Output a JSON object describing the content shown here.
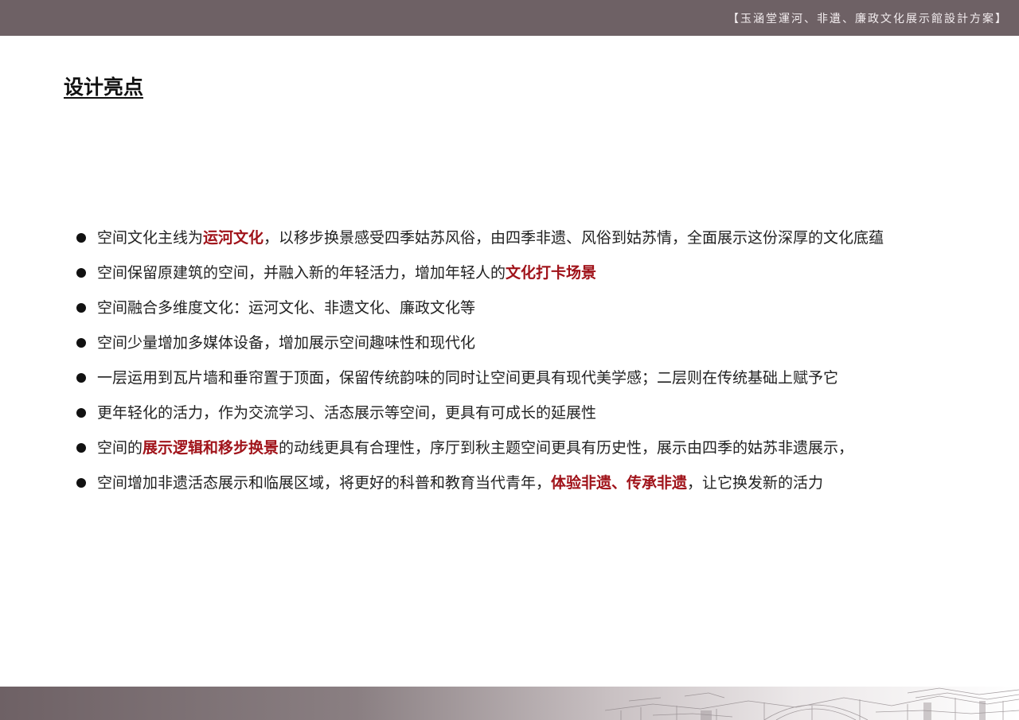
{
  "header": {
    "title": "【玉涵堂運河、非遺、廉政文化展示館設計方案】"
  },
  "page_title": "设计亮点",
  "bullets": [
    {
      "parts": [
        "空间文化主线为",
        "运河文化",
        "，以移步换景感受四季姑苏风俗，由四季非遗、风俗到姑苏情，全面展示这份深厚的文化底蕴"
      ]
    },
    {
      "parts": [
        "空间保留原建筑的空间，并融入新的年轻活力，增加年轻人的",
        "文化打卡场景",
        ""
      ]
    },
    {
      "parts": [
        "空间融合多维度文化：运河文化、非遗文化、廉政文化等",
        "",
        ""
      ]
    },
    {
      "parts": [
        "空间少量增加多媒体设备，增加展示空间趣味性和现代化",
        "",
        ""
      ]
    },
    {
      "parts": [
        "一层运用到瓦片墙和垂帘置于顶面，保留传统韵味的同时让空间更具有现代美学感；二层则在传统基础上赋予它",
        "",
        ""
      ]
    },
    {
      "parts": [
        "更年轻化的活力，作为交流学习、活态展示等空间，更具有可成长的延展性",
        "",
        ""
      ]
    },
    {
      "parts": [
        "空间的",
        "展示逻辑和移步换景",
        "的动线更具有合理性，序厅到秋主题空间更具有历史性，展示由四季的姑苏非遗展示，"
      ]
    },
    {
      "parts": [
        "空间增加非遗活态展示和临展区域，将更好的科普和教育当代青年，",
        "体验非遗、传承非遗",
        "，让它换发新的活力"
      ]
    }
  ],
  "colors": {
    "header_bar": "#6e6165",
    "highlight": "#a0131a",
    "text": "#222222"
  },
  "icons": {
    "bullet": "filled-circle",
    "footer_decoration": "architecture-sketch"
  }
}
